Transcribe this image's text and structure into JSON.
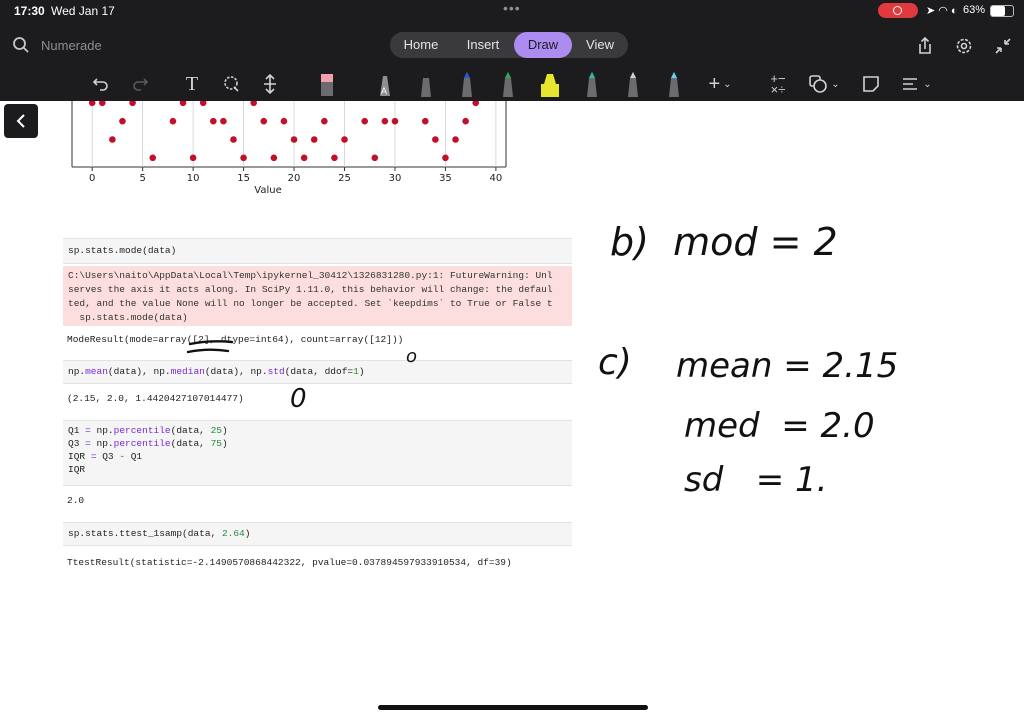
{
  "status": {
    "time": "17:30",
    "date": "Wed Jan 17",
    "battery": "63%"
  },
  "app": {
    "name": "Numerade"
  },
  "tabs": [
    {
      "label": "Home"
    },
    {
      "label": "Insert"
    },
    {
      "label": "Draw"
    },
    {
      "label": "View"
    }
  ],
  "active_tab": "Draw",
  "chart_data": {
    "type": "scatter",
    "xlabel": "Value",
    "x_ticks": [
      0,
      5,
      10,
      15,
      20,
      25,
      30,
      35,
      40
    ],
    "xlim": [
      -2,
      41
    ],
    "ylim": [
      0.5,
      4.1
    ],
    "points": [
      [
        0,
        4
      ],
      [
        1,
        4
      ],
      [
        2,
        2
      ],
      [
        3,
        3
      ],
      [
        4,
        4
      ],
      [
        6,
        1
      ],
      [
        8,
        3
      ],
      [
        9,
        4
      ],
      [
        10,
        1
      ],
      [
        11,
        4
      ],
      [
        12,
        3
      ],
      [
        13,
        3
      ],
      [
        14,
        2
      ],
      [
        15,
        1
      ],
      [
        16,
        4
      ],
      [
        17,
        3
      ],
      [
        18,
        1
      ],
      [
        19,
        3
      ],
      [
        20,
        2
      ],
      [
        21,
        1
      ],
      [
        22,
        2
      ],
      [
        23,
        3
      ],
      [
        24,
        1
      ],
      [
        25,
        2
      ],
      [
        27,
        3
      ],
      [
        28,
        1
      ],
      [
        29,
        3
      ],
      [
        30,
        3
      ],
      [
        33,
        3
      ],
      [
        34,
        2
      ],
      [
        35,
        1
      ],
      [
        36,
        2
      ],
      [
        37,
        3
      ],
      [
        38,
        4
      ]
    ],
    "point_color": "#c0102a"
  },
  "cells": {
    "mode_in": "sp.stats.mode(data)",
    "warn_lines": [
      "C:\\Users\\naito\\AppData\\Local\\Temp\\ipykernel_30412\\1326831280.py:1: FutureWarning: Unl",
      "serves the axis it acts along. In SciPy 1.11.0, this behavior will change: the defaul",
      "ted, and the value None will no longer be accepted. Set `keepdims` to True or False t",
      "  sp.stats.mode(data)"
    ],
    "mode_out": "ModeResult(mode=array([2], dtype=int64), count=array([12]))",
    "stats_in": {
      "a": "np.",
      "b": "mean",
      "c": "(data), np.",
      "d": "median",
      "e": "(data), np.",
      "f": "std",
      "g": "(data, ddof=",
      "h": "1",
      ")": ")"
    },
    "stats_out": "(2.15, 2.0, 1.4420427107014477)",
    "iqr_lines": {
      "l1a": "Q1 ",
      "l1b": "=",
      "l1c": " np.",
      "l1d": "percentile",
      "l1e": "(data, ",
      "l1f": "25",
      "l1g": ")",
      "l2a": "Q3 ",
      "l2b": "=",
      "l2c": " np.",
      "l2d": "percentile",
      "l2e": "(data, ",
      "l2f": "75",
      "l2g": ")",
      "l3a": "IQR ",
      "l3b": "=",
      "l3c": " Q3 ",
      "l3d": "-",
      "l3e": " Q1",
      "l4": "IQR"
    },
    "iqr_out": "2.0",
    "ttest_in": {
      "a": "sp.stats.ttest_1samp(data, ",
      "b": "2.64",
      "c": ")"
    },
    "ttest_out": "TtestResult(statistic=-2.1490570868442322, pvalue=0.037894597933910534, df=39)"
  },
  "handwriting": {
    "b": "b)  mod = 2",
    "c_label": "c)",
    "c1": "mean = 2.15",
    "c2": "med  = 2.0",
    "c3": "sd   = 1.",
    "zero_a": "o",
    "zero_b": "0"
  }
}
